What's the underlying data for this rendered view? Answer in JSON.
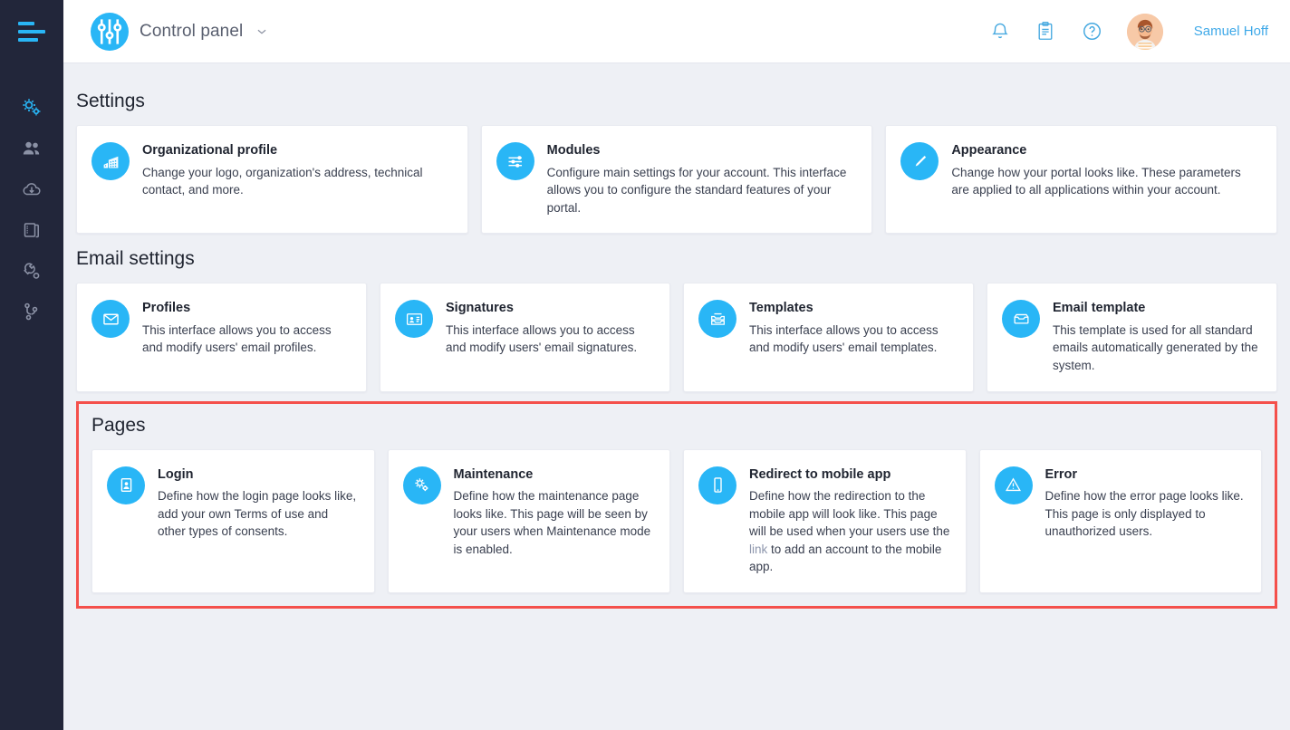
{
  "sidebar": {
    "menu_toggle": "hamburger-menu",
    "items": [
      {
        "name": "settings-gears",
        "icon": "gears-icon",
        "active": true
      },
      {
        "name": "users",
        "icon": "people-icon",
        "active": false
      },
      {
        "name": "downloads",
        "icon": "cloud-download-icon",
        "active": false
      },
      {
        "name": "documents",
        "icon": "notebook-icon",
        "active": false
      },
      {
        "name": "tools",
        "icon": "wrench-icon",
        "active": false
      },
      {
        "name": "workflows",
        "icon": "git-branch-icon",
        "active": false
      }
    ]
  },
  "topbar": {
    "app_icon": "sliders-icon",
    "title": "Control panel",
    "chevron": "chevron-down-icon",
    "icons": [
      {
        "name": "notifications-icon",
        "label": "bell-icon"
      },
      {
        "name": "tasks-icon",
        "label": "clipboard-icon"
      },
      {
        "name": "help-icon",
        "label": "question-mark-icon"
      }
    ],
    "user": {
      "name": "Samuel Hoff",
      "avatar": "user-avatar"
    }
  },
  "sections": [
    {
      "id": "settings",
      "title": "Settings",
      "highlighted": false,
      "cards": [
        {
          "icon": "building-icon",
          "title": "Organizational profile",
          "desc": "Change your logo, organization's address, technical contact, and more."
        },
        {
          "icon": "sliders-icon",
          "title": "Modules",
          "desc": "Configure main settings for your account. This interface allows you to configure the standard features of your portal."
        },
        {
          "icon": "pencil-icon",
          "title": "Appearance",
          "desc": "Change how your portal looks like. These parameters are applied to all applications within your account."
        }
      ]
    },
    {
      "id": "email-settings",
      "title": "Email settings",
      "highlighted": false,
      "cards": [
        {
          "icon": "envelope-icon",
          "title": "Profiles",
          "desc": "This interface allows you to access and modify users' email profiles."
        },
        {
          "icon": "contact-card-icon",
          "title": "Signatures",
          "desc": "This interface allows you to access and modify users' email signatures."
        },
        {
          "icon": "inbox-stack-icon",
          "title": "Templates",
          "desc": "This interface allows you to access and modify users' email templates."
        },
        {
          "icon": "inbox-icon",
          "title": "Email template",
          "desc": "This template is used for all standard emails automatically generated by the system."
        }
      ]
    },
    {
      "id": "pages",
      "title": "Pages",
      "highlighted": true,
      "highlight_color": "#f4504b",
      "cards": [
        {
          "icon": "id-card-icon",
          "title": "Login",
          "desc": "Define how the login page looks like, add your own Terms of use and other types of consents."
        },
        {
          "icon": "gears-icon",
          "title": "Maintenance",
          "desc": "Define how the maintenance page looks like. This page will be seen by your users when Maintenance mode is enabled."
        },
        {
          "icon": "mobile-phone-icon",
          "title": "Redirect to mobile app",
          "desc_parts": [
            {
              "text": "Define how the redirection to the mobile app will look like. This page will be used when your users use the ",
              "link": false
            },
            {
              "text": "link",
              "link": true
            },
            {
              "text": " to add an account to the mobile app.",
              "link": false
            }
          ],
          "desc": "Define how the redirection to the mobile app will look like. This page will be used when your users use the link to add an account to the mobile app."
        },
        {
          "icon": "warning-triangle-icon",
          "title": "Error",
          "desc": "Define how the error page looks like. This page is only displayed to unauthorized users."
        }
      ]
    }
  ],
  "colors": {
    "accent": "#29b6f6",
    "sidebar_bg": "#22263a",
    "page_bg": "#eef0f5",
    "highlight": "#f4504b",
    "link": "#3fa9e8"
  }
}
